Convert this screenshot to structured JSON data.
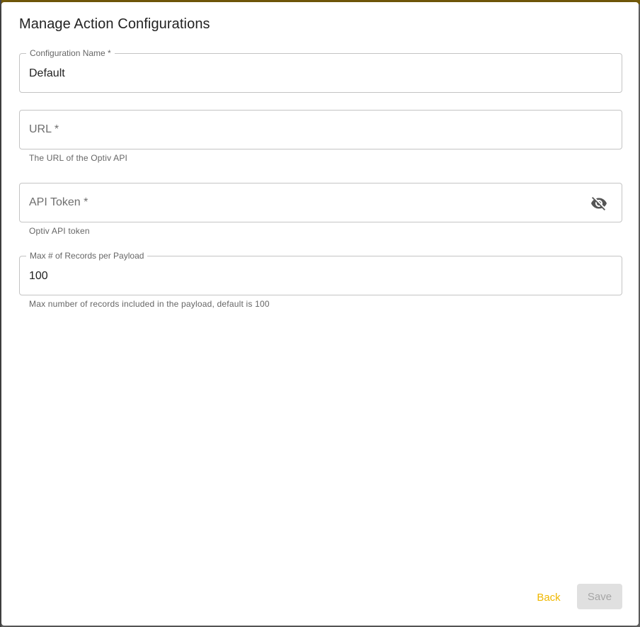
{
  "dialog": {
    "title": "Manage Action Configurations"
  },
  "form": {
    "config_name": {
      "label": "Configuration Name *",
      "value": "Default"
    },
    "url": {
      "placeholder": "URL *",
      "value": "",
      "helper": "The URL of the Optiv API"
    },
    "api_token": {
      "placeholder": "API Token *",
      "value": "",
      "helper": "Optiv API token",
      "toggle_icon": "visibility-off-icon"
    },
    "max_records": {
      "label": "Max # of Records per Payload",
      "value": "100",
      "helper": "Max number of records included in the payload, default is 100"
    }
  },
  "actions": {
    "back_label": "Back",
    "save_label": "Save"
  },
  "colors": {
    "accent": "#f0b800",
    "disabled_bg": "#e0e0e0",
    "disabled_text": "#a6a6a6"
  }
}
